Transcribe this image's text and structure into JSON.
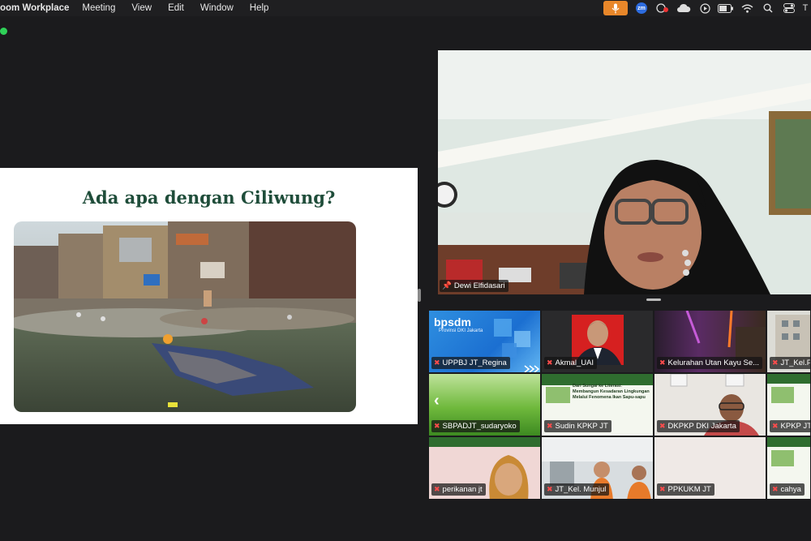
{
  "menubar": {
    "app_name": "oom Workplace",
    "menus": [
      "Meeting",
      "View",
      "Edit",
      "Window",
      "Help"
    ],
    "zoom_badge": "zm",
    "trailing_letter": "T"
  },
  "slide": {
    "title": "Ada apa dengan Ciliwung?"
  },
  "speaker": {
    "name": "Dewi Elfidasari"
  },
  "gallery": {
    "tiles": [
      {
        "name": "UPPBJ JT_Regina",
        "muted": true
      },
      {
        "name": "Akmal_UAI",
        "muted": true
      },
      {
        "name": "Kelurahan Utan Kayu Se...",
        "muted": true
      },
      {
        "name": "JT_Kel.P",
        "muted": true
      },
      {
        "name": "SBPADJT_sudaryoko",
        "muted": true
      },
      {
        "name": "Sudin KPKP JT",
        "muted": true
      },
      {
        "name": "DKPKP DKI Jakarta",
        "muted": true
      },
      {
        "name": "KPKP JT",
        "muted": true
      },
      {
        "name": "perikanan jt",
        "muted": true
      },
      {
        "name": "JT_Kel. Munjul",
        "muted": true
      },
      {
        "name": "PPKUKM JT",
        "muted": true
      },
      {
        "name": "cahya",
        "muted": true
      }
    ],
    "bps_logo": "bpsdm",
    "bps_sub": "Provinsi DKI Jakarta",
    "poster_line1": "Dari Sungai ke Literasi:",
    "poster_line2": "Membangun Kesadaran Lingkungan",
    "poster_line3": "Melalui Fenomena Ikan Sapu-sapu"
  },
  "colors": {
    "accent_orange": "#e8872a",
    "active_dot": "#2fd158",
    "slide_title": "#1f4d3a",
    "mute_red": "#ff4c4c"
  }
}
